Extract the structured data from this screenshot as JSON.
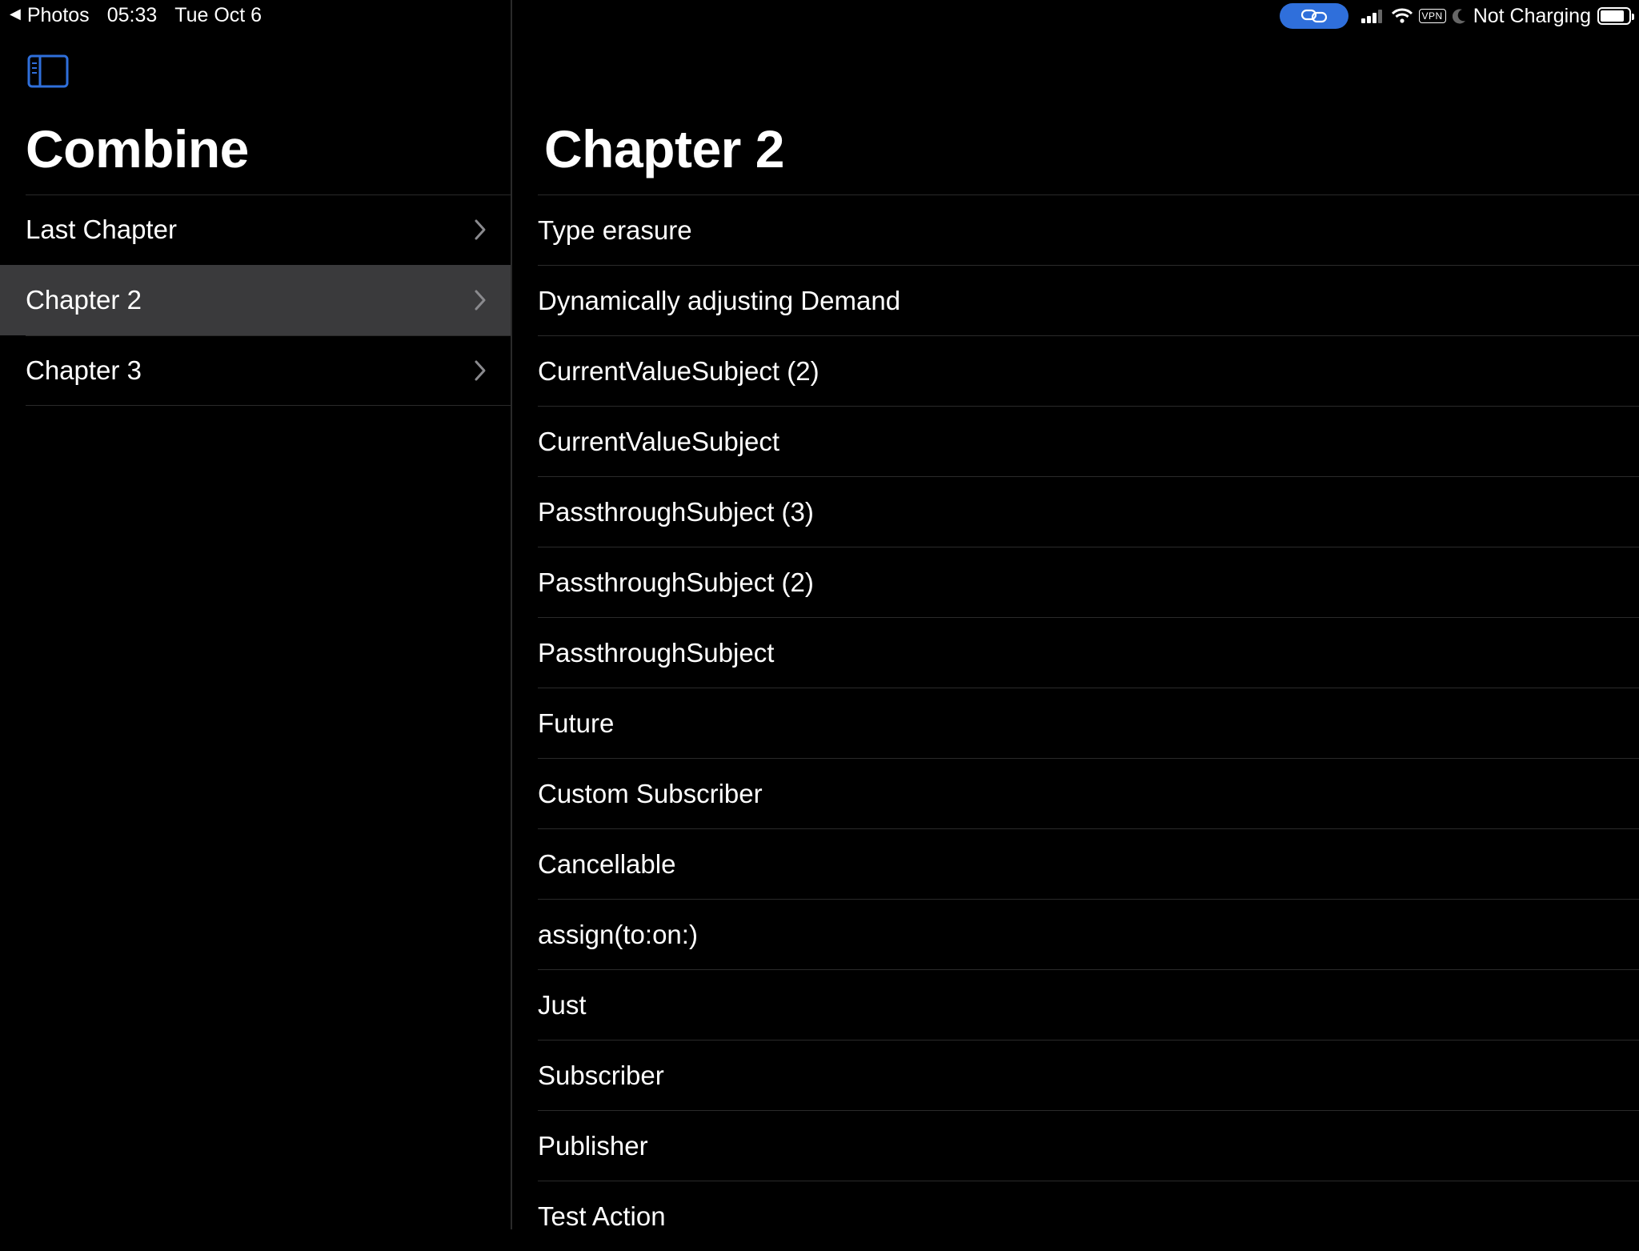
{
  "status_bar": {
    "back_app": "Photos",
    "time": "05:33",
    "date": "Tue Oct 6",
    "vpn": "VPN",
    "battery_text": "Not Charging",
    "battery_level": 0.85
  },
  "sidebar": {
    "title": "Combine",
    "items": [
      {
        "label": "Last Chapter"
      },
      {
        "label": "Chapter 2",
        "selected": true
      },
      {
        "label": "Chapter 3"
      }
    ]
  },
  "main": {
    "title": "Chapter 2",
    "items": [
      "Type erasure",
      "Dynamically adjusting Demand",
      "CurrentValueSubject (2)",
      "CurrentValueSubject",
      "PassthroughSubject (3)",
      "PassthroughSubject (2)",
      "PassthroughSubject",
      "Future",
      "Custom Subscriber",
      "Cancellable",
      "assign(to:on:)",
      "Just",
      "Subscriber",
      "Publisher",
      "Test Action"
    ]
  },
  "colors": {
    "accent": "#2f6fdb",
    "selected_row": "#3a3a3c",
    "background": "#000000",
    "separator": "#2a2a2a"
  },
  "icons": [
    "back-arrow-icon",
    "link-icon",
    "signal-icon",
    "wifi-icon",
    "moon-icon",
    "battery-icon",
    "sidebar-toggle-icon",
    "chevron-right-icon"
  ]
}
